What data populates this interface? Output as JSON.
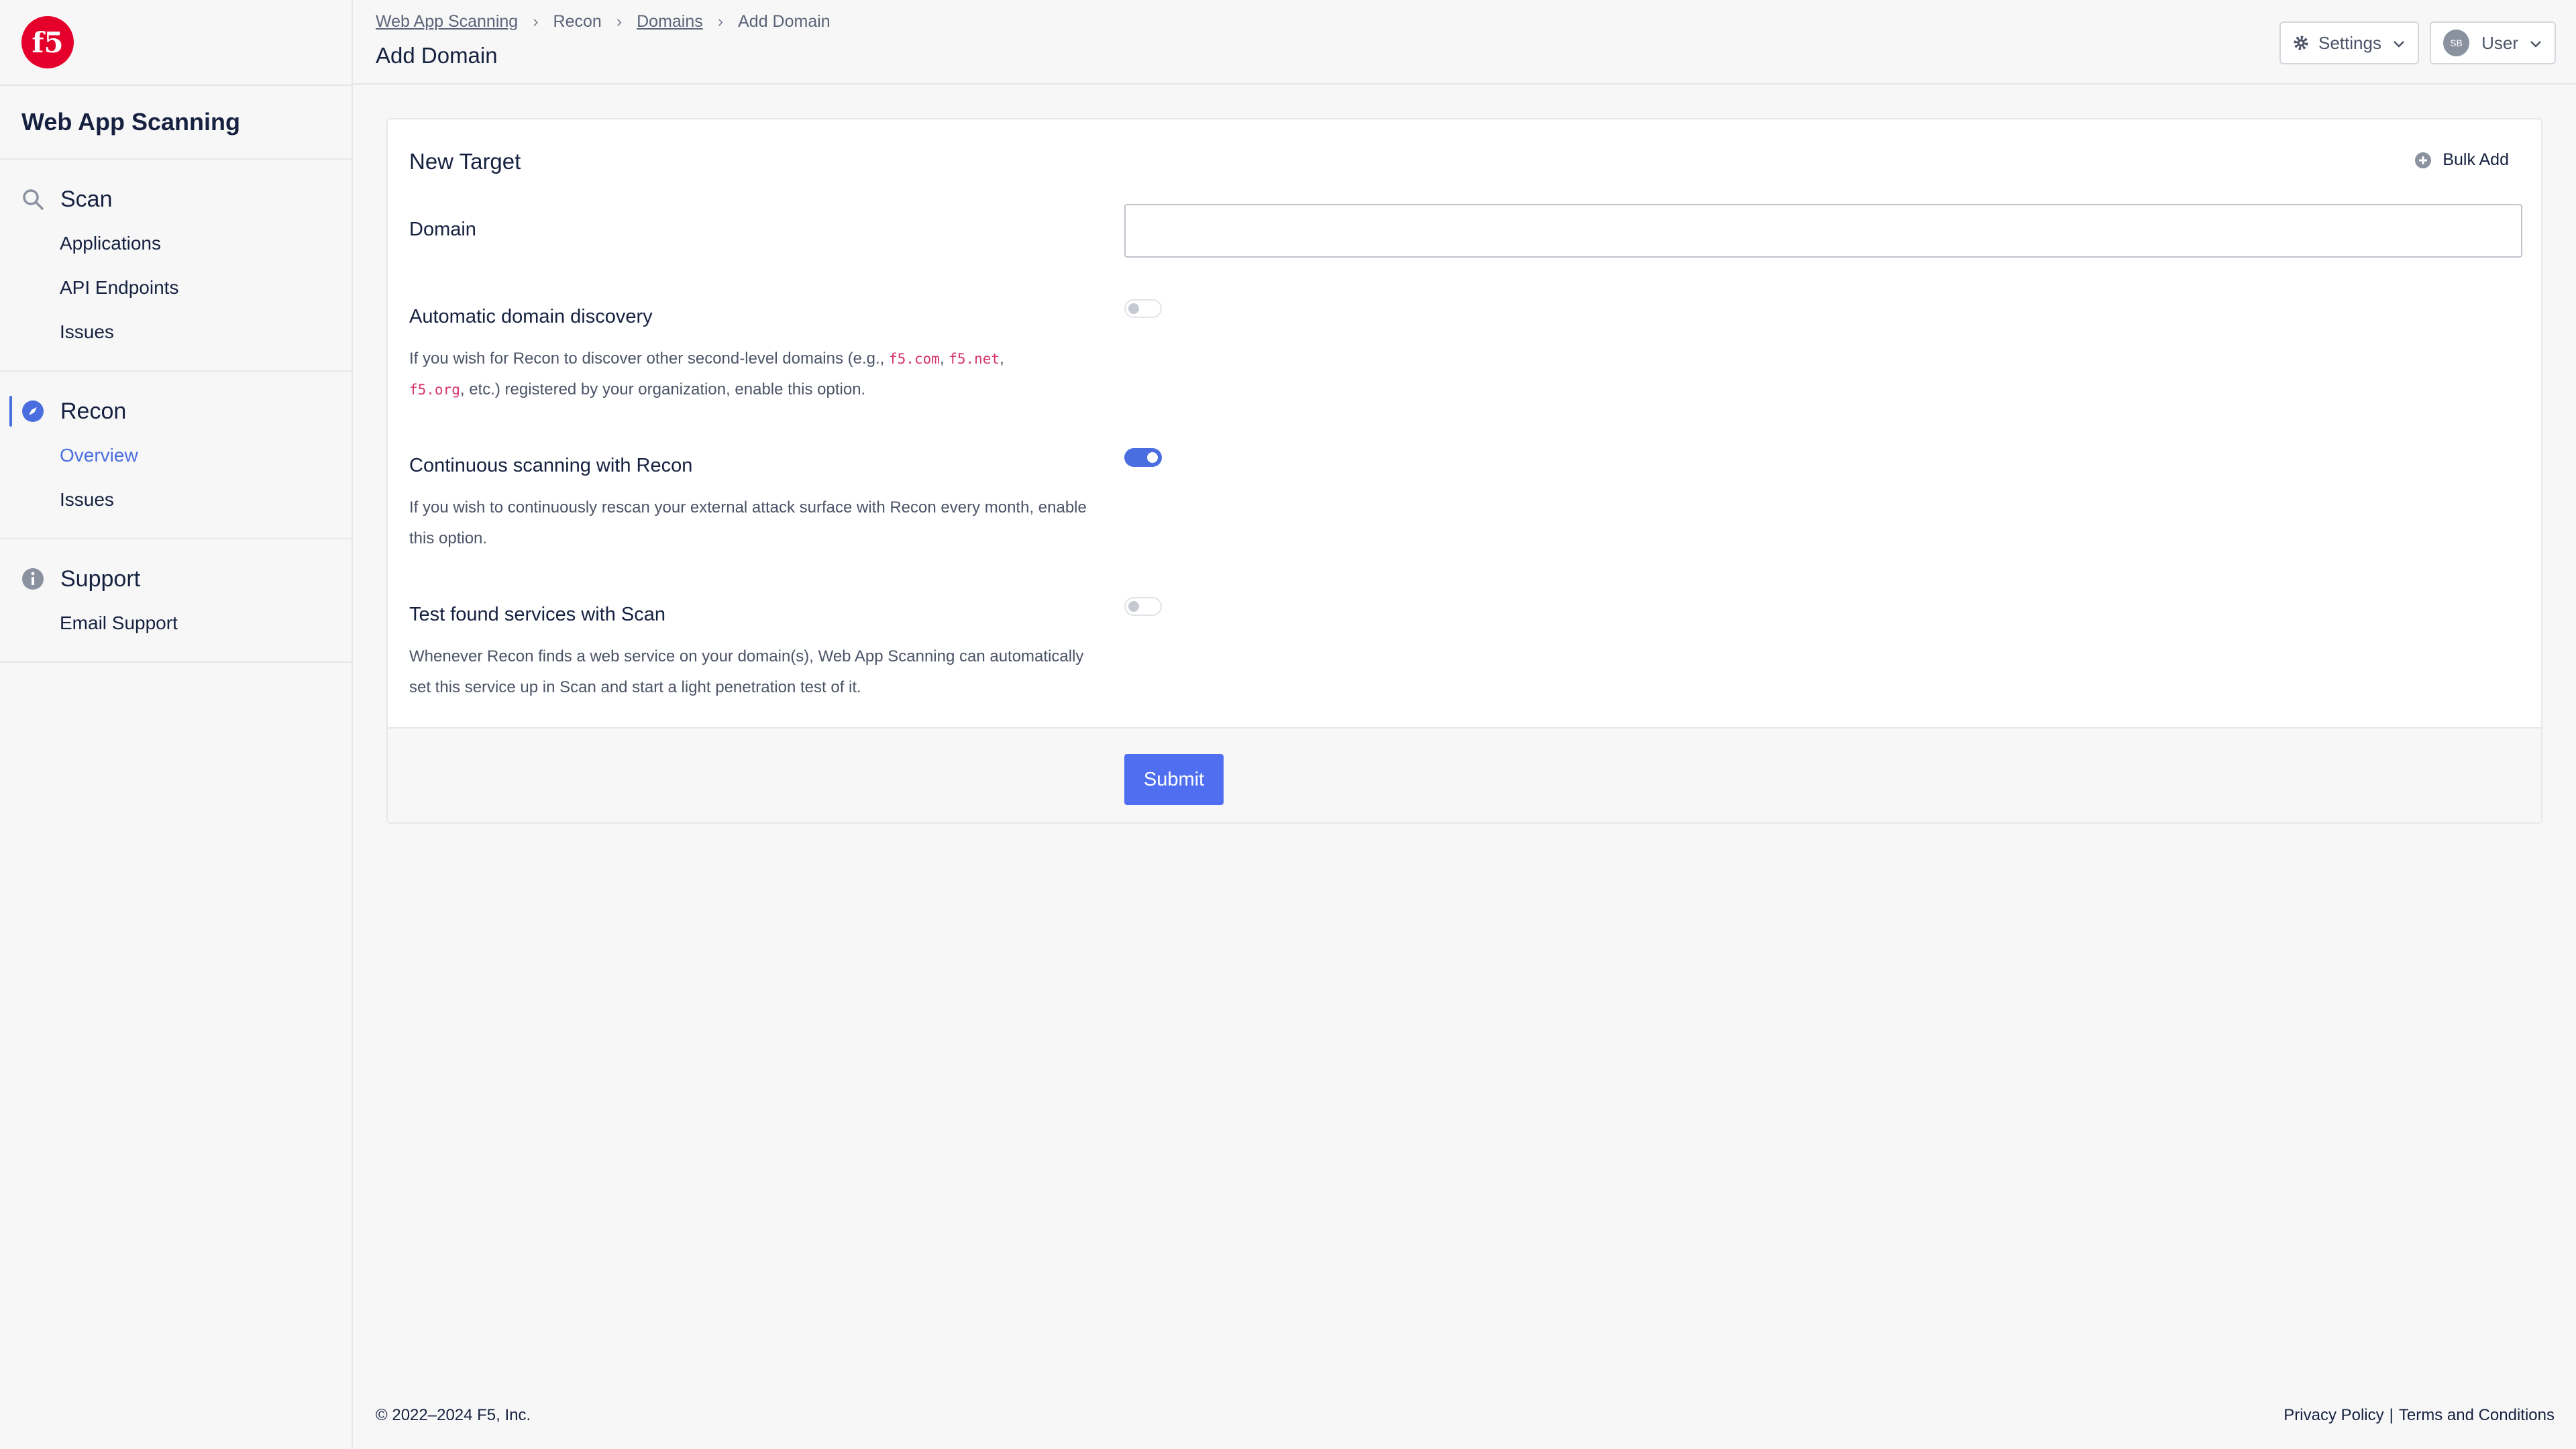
{
  "sidebar": {
    "logo_text": "f5",
    "app_title": "Web App Scanning",
    "sections": [
      {
        "label": "Scan",
        "icon": "search-icon",
        "items": [
          "Applications",
          "API Endpoints",
          "Issues"
        ]
      },
      {
        "label": "Recon",
        "icon": "compass-icon",
        "items": [
          "Overview",
          "Issues"
        ],
        "active_item": "Overview"
      },
      {
        "label": "Support",
        "icon": "info-icon",
        "items": [
          "Email Support"
        ]
      }
    ]
  },
  "header": {
    "breadcrumb": [
      "Web App Scanning",
      "Recon",
      "Domains",
      "Add Domain"
    ],
    "breadcrumb_separator": "›",
    "page_title": "Add Domain",
    "settings_label": "Settings",
    "user_initials": "SB",
    "user_label": "User"
  },
  "form": {
    "title": "New Target",
    "bulk_add_label": "Bulk Add",
    "domain": {
      "label": "Domain",
      "value": "",
      "placeholder": ""
    },
    "auto_discovery": {
      "label": "Automatic domain discovery",
      "help_prefix": "If you wish for Recon to discover other second-level domains (e.g., ",
      "code1": "f5.com",
      "comma": ", ",
      "code2": "f5.net",
      "comma2": ",",
      "code3": "f5.org",
      "help_suffix": ", etc.) registered by your organization, enable this option.",
      "enabled": false
    },
    "continuous": {
      "label": "Continuous scanning with Recon",
      "help": "If you wish to continuously rescan your external attack surface with Recon every month, enable this option.",
      "enabled": true
    },
    "test_services": {
      "label": "Test found services with Scan",
      "help": "Whenever Recon finds a web service on your domain(s), Web App Scanning can automatically set this service up in Scan and start a light penetration test of it.",
      "enabled": false
    },
    "submit_label": "Submit"
  },
  "footer": {
    "copyright": "© 2022–2024 F5, Inc.",
    "privacy": "Privacy Policy",
    "divider": "|",
    "terms": "Terms and Conditions"
  },
  "colors": {
    "accent": "#4a6ee0",
    "brand_red": "#e4002b",
    "submit": "#4f6ff0"
  }
}
